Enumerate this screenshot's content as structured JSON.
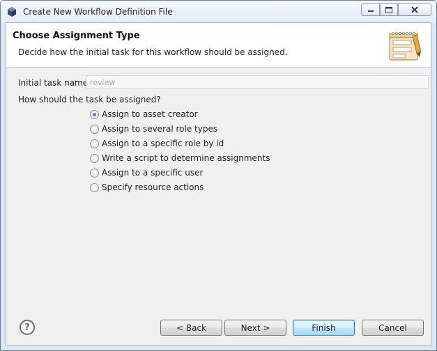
{
  "window": {
    "title": "Create New Workflow Definition File"
  },
  "header": {
    "title": "Choose Assignment Type",
    "description": "Decide how the initial task for this workflow should be assigned."
  },
  "form": {
    "task_name_label": "Initial task name:",
    "task_name_value": "review",
    "question": "How should the task be assigned?",
    "options": [
      {
        "label": "Assign to asset creator",
        "checked": true
      },
      {
        "label": "Assign to several role types",
        "checked": false
      },
      {
        "label": "Assign to a specific role by id",
        "checked": false
      },
      {
        "label": "Write a script to determine assignments",
        "checked": false
      },
      {
        "label": "Assign to a specific user",
        "checked": false
      },
      {
        "label": "Specify resource actions",
        "checked": false
      }
    ]
  },
  "buttons": {
    "help": "?",
    "back": "< Back",
    "next": "Next >",
    "finish": "Finish",
    "cancel": "Cancel"
  }
}
